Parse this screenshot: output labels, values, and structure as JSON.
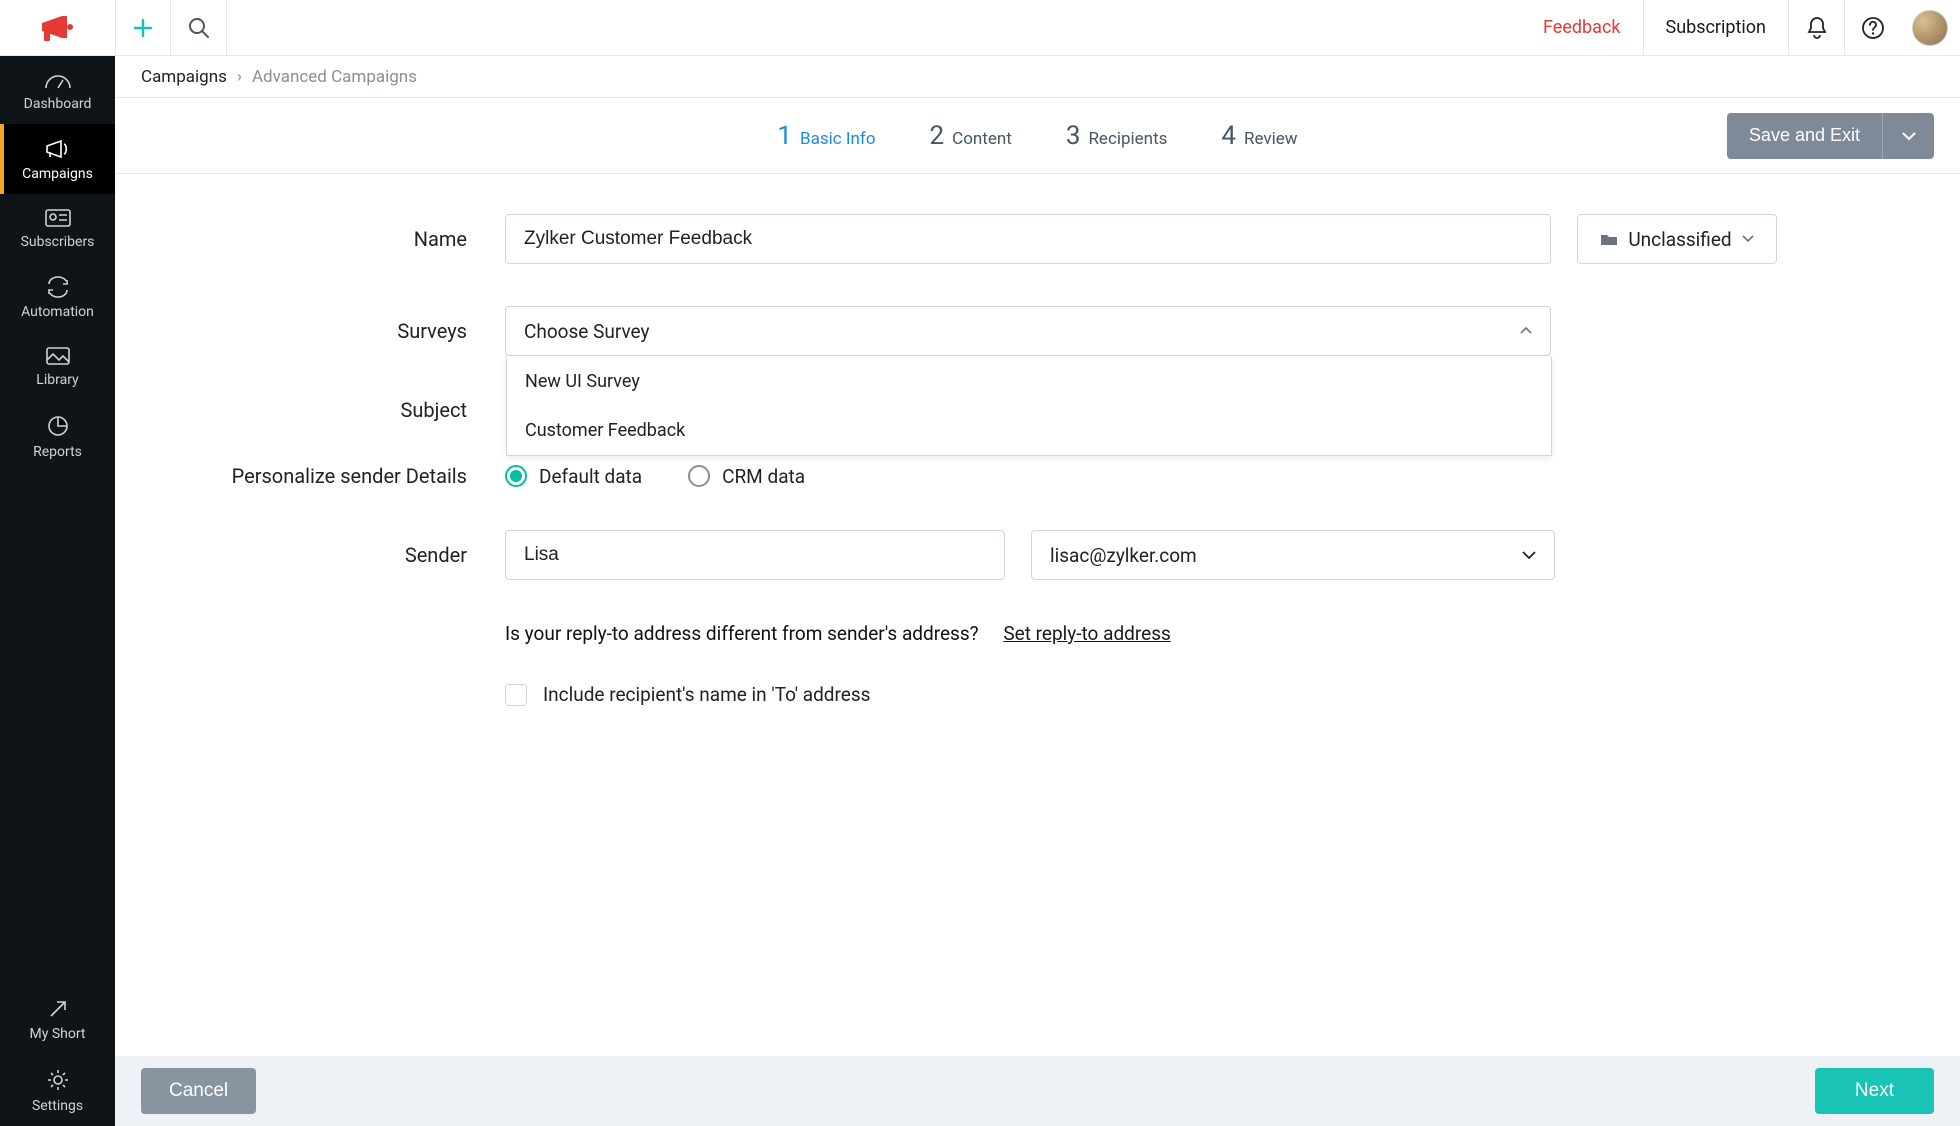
{
  "topbar": {
    "feedback": "Feedback",
    "subscription": "Subscription"
  },
  "sidebar": {
    "items": [
      {
        "label": "Dashboard"
      },
      {
        "label": "Campaigns"
      },
      {
        "label": "Subscribers"
      },
      {
        "label": "Automation"
      },
      {
        "label": "Library"
      },
      {
        "label": "Reports"
      }
    ],
    "bottom": [
      {
        "label": "My Short"
      },
      {
        "label": "Settings"
      }
    ]
  },
  "breadcrumb": {
    "root": "Campaigns",
    "current": "Advanced Campaigns"
  },
  "steps": [
    {
      "num": "1",
      "label": "Basic Info"
    },
    {
      "num": "2",
      "label": "Content"
    },
    {
      "num": "3",
      "label": "Recipients"
    },
    {
      "num": "4",
      "label": "Review"
    }
  ],
  "actions": {
    "save_exit": "Save and Exit",
    "cancel": "Cancel",
    "next": "Next"
  },
  "form": {
    "name_label": "Name",
    "name_value": "Zylker Customer Feedback",
    "classify_label": "Unclassified",
    "surveys_label": "Surveys",
    "surveys_placeholder": "Choose Survey",
    "surveys_options": [
      "New UI Survey",
      "Customer Feedback"
    ],
    "subject_label": "Subject",
    "personalize_label": "Personalize sender Details",
    "radio_default": "Default data",
    "radio_crm": "CRM data",
    "sender_label": "Sender",
    "sender_name": "Lisa",
    "sender_email": "lisac@zylker.com",
    "replyto_question": "Is your reply-to address different from sender's address?",
    "replyto_link": "Set reply-to address",
    "include_recipient": "Include recipient's name in 'To' address"
  }
}
